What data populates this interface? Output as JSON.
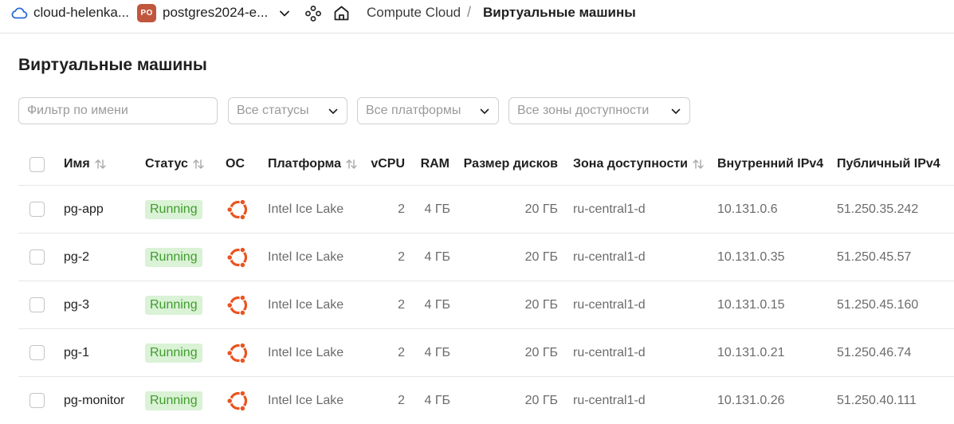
{
  "header": {
    "cloud_name": "cloud-helenka...",
    "folder_badge": "PO",
    "folder_name": "postgres2024-e...",
    "breadcrumb_service": "Compute Cloud",
    "breadcrumb_sep": "/",
    "breadcrumb_current": "Виртуальные машины"
  },
  "page": {
    "title": "Виртуальные машины"
  },
  "filters": {
    "name_placeholder": "Фильтр по имени",
    "status": "Все статусы",
    "platform": "Все платформы",
    "zone": "Все зоны доступности"
  },
  "table": {
    "columns": {
      "name": "Имя",
      "status": "Статус",
      "os": "ОС",
      "platform": "Платформа",
      "vcpu": "vCPU",
      "ram": "RAM",
      "disk": "Размер дисков",
      "zone": "Зона доступности",
      "internal_ip": "Внутренний IPv4",
      "public_ip": "Публичный IPv4"
    },
    "rows": [
      {
        "name": "pg-app",
        "status": "Running",
        "os_icon": "ubuntu-icon",
        "platform": "Intel Ice Lake",
        "vcpu": "2",
        "ram": "4 ГБ",
        "disk": "20 ГБ",
        "zone": "ru-central1-d",
        "internal_ip": "10.131.0.6",
        "public_ip": "51.250.35.242"
      },
      {
        "name": "pg-2",
        "status": "Running",
        "os_icon": "ubuntu-icon",
        "platform": "Intel Ice Lake",
        "vcpu": "2",
        "ram": "4 ГБ",
        "disk": "20 ГБ",
        "zone": "ru-central1-d",
        "internal_ip": "10.131.0.35",
        "public_ip": "51.250.45.57"
      },
      {
        "name": "pg-3",
        "status": "Running",
        "os_icon": "ubuntu-icon",
        "platform": "Intel Ice Lake",
        "vcpu": "2",
        "ram": "4 ГБ",
        "disk": "20 ГБ",
        "zone": "ru-central1-d",
        "internal_ip": "10.131.0.15",
        "public_ip": "51.250.45.160"
      },
      {
        "name": "pg-1",
        "status": "Running",
        "os_icon": "ubuntu-icon",
        "platform": "Intel Ice Lake",
        "vcpu": "2",
        "ram": "4 ГБ",
        "disk": "20 ГБ",
        "zone": "ru-central1-d",
        "internal_ip": "10.131.0.21",
        "public_ip": "51.250.46.74"
      },
      {
        "name": "pg-monitor",
        "status": "Running",
        "os_icon": "ubuntu-icon",
        "platform": "Intel Ice Lake",
        "vcpu": "2",
        "ram": "4 ГБ",
        "disk": "20 ГБ",
        "zone": "ru-central1-d",
        "internal_ip": "10.131.0.26",
        "public_ip": "51.250.40.111"
      }
    ]
  },
  "colors": {
    "status_running_bg": "#daf2d6",
    "status_running_text": "#3f9d2c",
    "folder_badge_bg": "#c0563d",
    "ubuntu_orange": "#e95420",
    "cloud_icon": "#2a6bd8"
  }
}
